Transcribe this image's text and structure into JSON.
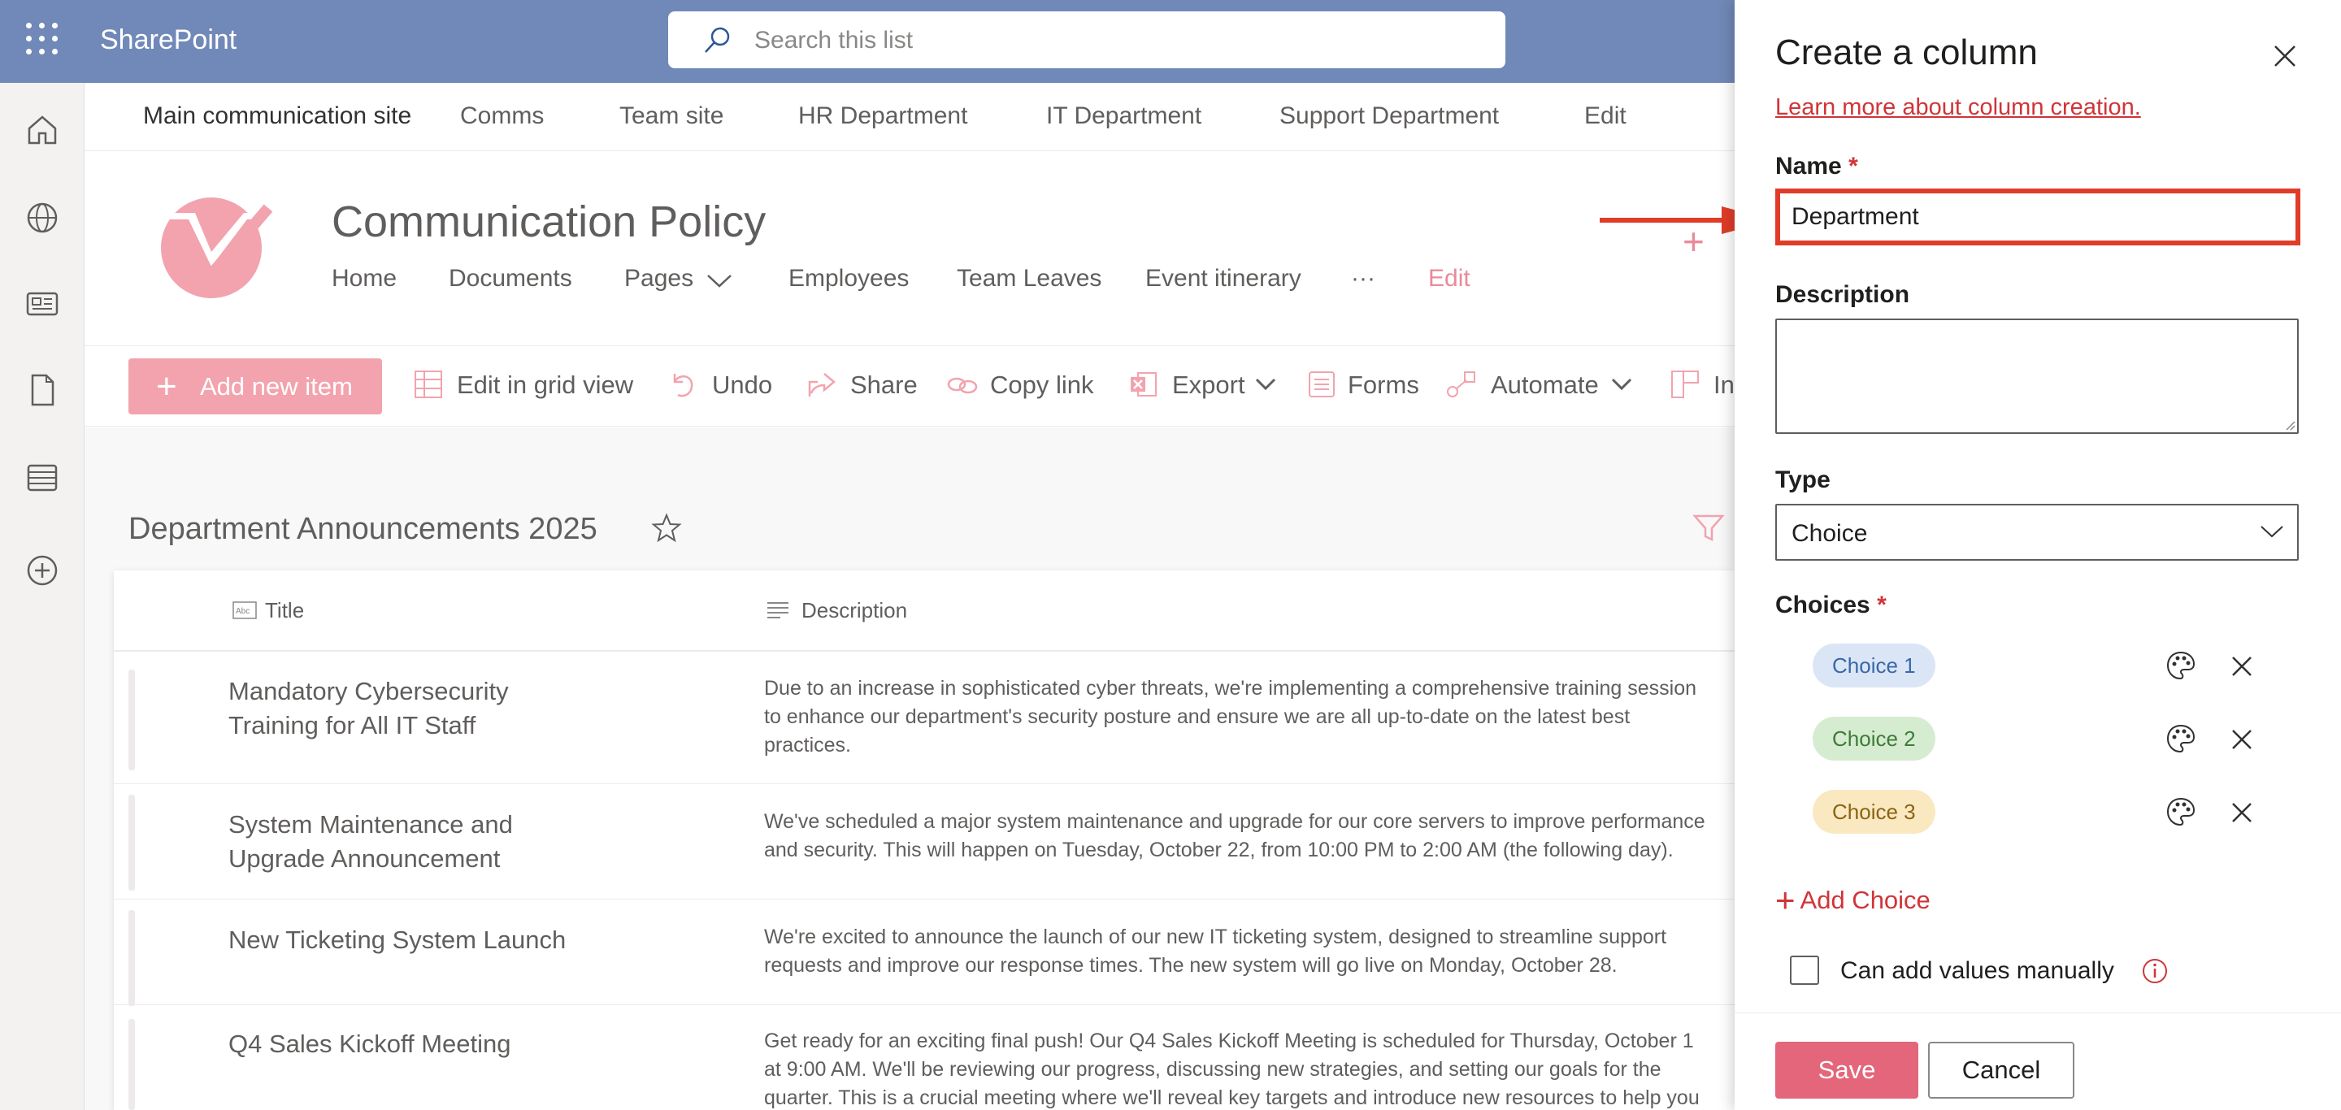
{
  "suite": {
    "brand": "SharePoint",
    "search_placeholder": "Search this list"
  },
  "hubnav": [
    "Main communication site",
    "Comms",
    "Team site",
    "HR Department",
    "IT Department",
    "Support Department",
    "Edit"
  ],
  "site": {
    "title": "Communication Policy",
    "nav": [
      "Home",
      "Documents",
      "Pages",
      "Employees",
      "Team Leaves",
      "Event itinerary",
      "···",
      "Edit"
    ]
  },
  "commands": {
    "add_new": "Add new item",
    "edit_grid": "Edit in grid view",
    "undo": "Undo",
    "share": "Share",
    "copy_link": "Copy link",
    "export": "Export",
    "forms": "Forms",
    "automate": "Automate",
    "integrate": "In"
  },
  "list": {
    "title": "Department Announcements 2025",
    "columns": [
      "Title",
      "Description"
    ],
    "rows": [
      {
        "title": "Mandatory Cybersecurity Training for All IT Staff",
        "desc": "Due to an increase in sophisticated cyber threats, we're implementing a comprehensive training session\nto enhance our department's security posture and ensure we are all up-to-date on the latest best\npractices."
      },
      {
        "title": "System Maintenance and Upgrade Announcement",
        "desc": "We've scheduled a major system maintenance and upgrade for our core servers to improve performance\nand security. This will happen on Tuesday, October 22, from 10:00 PM to 2:00 AM (the following day)."
      },
      {
        "title": "New Ticketing System Launch",
        "desc": "We're excited to announce the launch of our new IT ticketing system, designed to streamline support\nrequests and improve our response times. The new system will go live on Monday, October 28."
      },
      {
        "title": "Q4 Sales Kickoff Meeting",
        "desc": "Get ready for an exciting final push! Our Q4 Sales Kickoff Meeting is scheduled for Thursday, October 1\nat 9:00 AM. We'll be reviewing our progress, discussing new strategies, and setting our goals for the\nquarter. This is a crucial meeting where we'll reveal key targets and introduce new resources to help you"
      }
    ]
  },
  "panel": {
    "title": "Create a column",
    "learn_more": "Learn more about column creation.",
    "name_label": "Name",
    "name_value": "Department",
    "description_label": "Description",
    "type_label": "Type",
    "type_value": "Choice",
    "choices_label": "Choices",
    "required_mark": "*",
    "choices": [
      {
        "label": "Choice 1",
        "bg": "#dae6f6",
        "fg": "#3a67a8"
      },
      {
        "label": "Choice 2",
        "bg": "#d5ecd0",
        "fg": "#3f7a3a"
      },
      {
        "label": "Choice 3",
        "bg": "#f9e8c0",
        "fg": "#8a6414"
      }
    ],
    "add_choice": "Add Choice",
    "manual_label": "Can add values manually",
    "save": "Save",
    "cancel": "Cancel"
  },
  "colors": {
    "accent": "#e4667a",
    "suitebar": "#7189b8",
    "highlight": "#e03c28"
  }
}
